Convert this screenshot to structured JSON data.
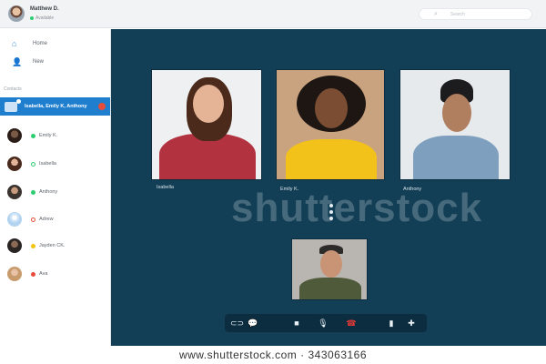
{
  "user": {
    "name": "Matthew D.",
    "status": "Available"
  },
  "search": {
    "placeholder": "Search"
  },
  "nav": [
    {
      "label": "Home",
      "icon": "home-icon"
    },
    {
      "label": "New",
      "icon": "add-user-icon"
    }
  ],
  "contacts_section": "Contacts",
  "active_group": {
    "label": "Isabella, Emily K, Anthony",
    "badge": "●"
  },
  "contacts": [
    {
      "name": "Emily K.",
      "status": "online",
      "color": "#2ecc71"
    },
    {
      "name": "Isabella",
      "status": "offline",
      "color": "#2ecc71"
    },
    {
      "name": "Anthony",
      "status": "online",
      "color": "#2ecc71"
    },
    {
      "name": "Adrew",
      "status": "offline",
      "color": "#e74c3c"
    },
    {
      "name": "Jayden CK.",
      "status": "away",
      "color": "#f1c40f"
    },
    {
      "name": "Ava",
      "status": "busy",
      "color": "#e74c3c"
    }
  ],
  "participants": [
    {
      "name": "Isabella"
    },
    {
      "name": "Emily K."
    },
    {
      "name": "Anthony"
    }
  ],
  "controls": [
    {
      "icon": "link-icon",
      "glyph": "⊂⊃"
    },
    {
      "icon": "chat-icon",
      "glyph": "💬"
    },
    {
      "icon": "video-icon",
      "glyph": "■"
    },
    {
      "icon": "microphone-icon",
      "glyph": "🎙"
    },
    {
      "icon": "hang-up-icon",
      "glyph": "☎"
    },
    {
      "icon": "signal-icon",
      "glyph": "▮"
    },
    {
      "icon": "add-participant-icon",
      "glyph": "✚"
    }
  ],
  "watermark": "shutterstock",
  "footer": "www.shutterstock.com · 343063166",
  "colors": {
    "accent": "#1f7fce",
    "call_bg": "#123f56",
    "hangup": "#e53935"
  }
}
